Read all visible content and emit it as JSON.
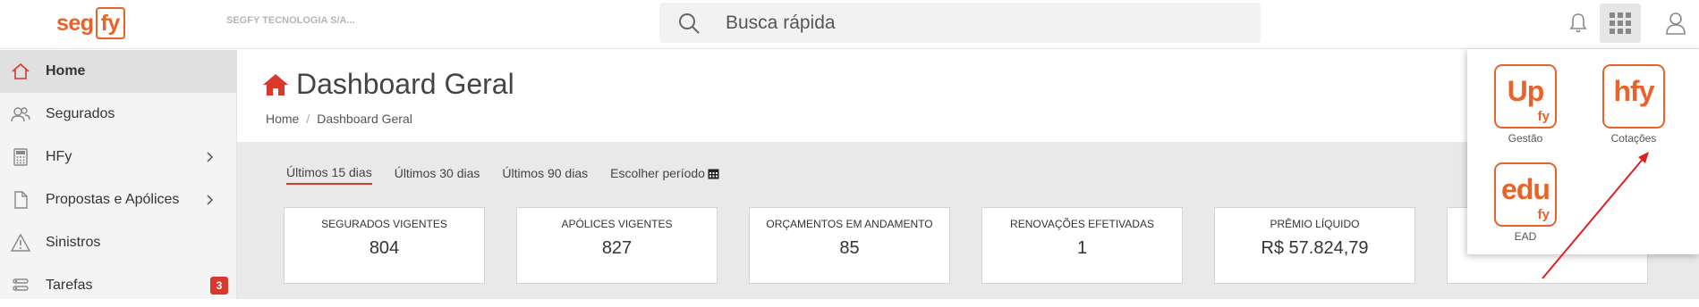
{
  "header": {
    "logo_left": "seg",
    "logo_right": "fy",
    "company": "SEGFY TECNOLOGIA S/A...",
    "search_placeholder": "Busca rápida",
    "icons": [
      "search-icon",
      "bell-icon",
      "apps-grid-icon",
      "user-icon"
    ]
  },
  "sidebar": {
    "items": [
      {
        "label": "Home",
        "icon": "home-icon",
        "active": true
      },
      {
        "label": "Segurados",
        "icon": "users-icon"
      },
      {
        "label": "HFy",
        "icon": "calculator-icon",
        "has_submenu": true
      },
      {
        "label": "Propostas e Apólices",
        "icon": "document-icon",
        "has_submenu": true
      },
      {
        "label": "Sinistros",
        "icon": "warning-icon"
      },
      {
        "label": "Tarefas",
        "icon": "tasks-icon",
        "badge": "3"
      }
    ]
  },
  "page": {
    "title": "Dashboard Geral",
    "breadcrumb": [
      "Home",
      "Dashboard Geral"
    ]
  },
  "filters": {
    "options": [
      "Últimos 15 dias",
      "Últimos 30 dias",
      "Últimos 90 dias",
      "Escolher período"
    ],
    "active": "Últimos 15 dias"
  },
  "kpis": [
    {
      "label": "SEGURADOS VIGENTES",
      "value": "804"
    },
    {
      "label": "APÓLICES VIGENTES",
      "value": "827"
    },
    {
      "label": "ORÇAMENTOS EM ANDAMENTO",
      "value": "85"
    },
    {
      "label": "RENOVAÇÕES EFETIVADAS",
      "value": "1"
    },
    {
      "label": "PRÊMIO LÍQUIDO",
      "value": "R$ 57.824,79"
    },
    {
      "label": "",
      "value": ""
    }
  ],
  "apps_menu": {
    "apps": [
      {
        "name": "Gestão",
        "logo_big": "Up",
        "logo_small": "fy"
      },
      {
        "name": "Cotações",
        "logo_big": "hfy",
        "logo_small": ""
      },
      {
        "name": "EAD",
        "logo_big": "edu",
        "logo_small": "fy"
      }
    ]
  },
  "colors": {
    "brand_orange": "#e8622a",
    "active_red": "#d9382c",
    "annotation_arrow": "#e02020"
  }
}
